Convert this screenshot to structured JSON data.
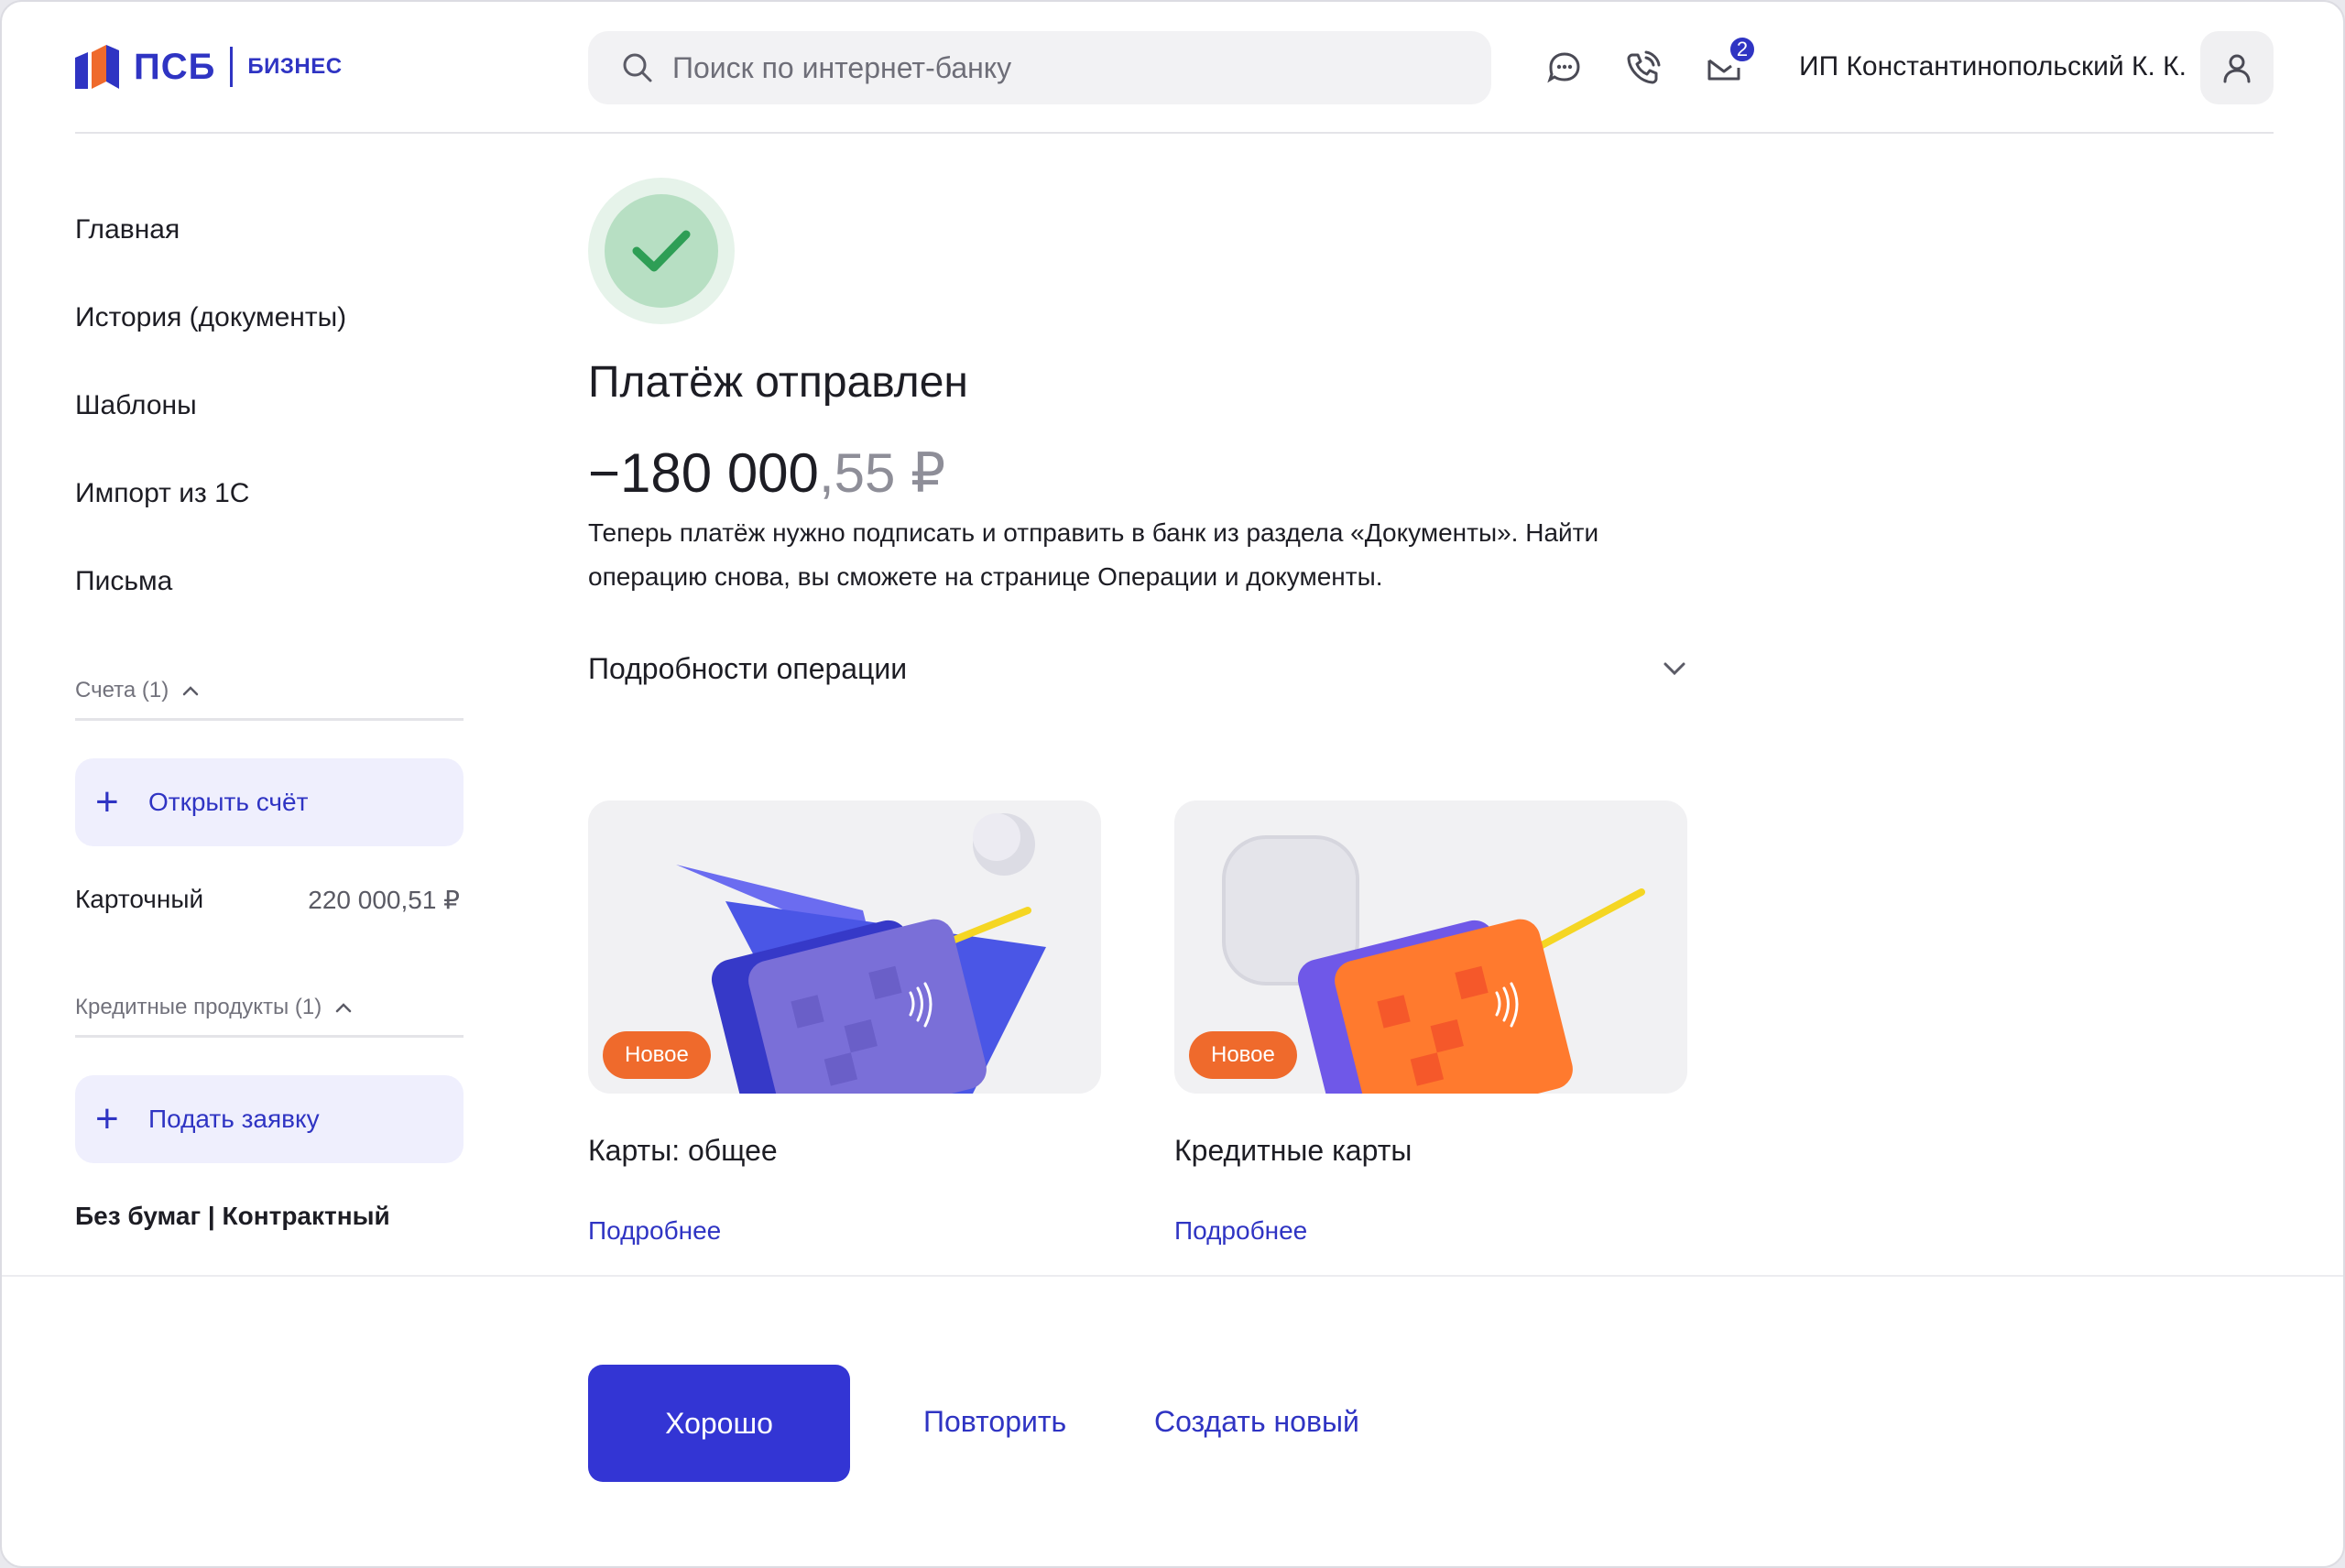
{
  "brand": {
    "name": "ПСБ",
    "sub": "БИЗНЕС"
  },
  "header": {
    "search_placeholder": "Поиск по интернет-банку",
    "notification_count": "2",
    "user_name": "ИП Константинопольский К. К."
  },
  "sidebar": {
    "nav": [
      "Главная",
      "История (документы)",
      "Шаблоны",
      "Импорт из 1С",
      "Письма"
    ],
    "accounts_title": "Счета (1)",
    "open_account_label": "Открыть счёт",
    "account": {
      "name": "Карточный",
      "balance": "220 000,51 ₽"
    },
    "credit_title": "Кредитные продукты (1)",
    "apply_label": "Подать заявку",
    "footer_note": "Без бумаг | Контрактный"
  },
  "main": {
    "status_title": "Платёж отправлен",
    "amount_main": "−180 000",
    "amount_frac": ",55 ₽",
    "description": "Теперь платёж нужно подписать и отправить в банк из раздела «Документы». Найти операцию снова, вы сможете на странице Операции и документы.",
    "details_label": "Подробности операции",
    "offers": [
      {
        "badge": "Новое",
        "title": "Карты: общее",
        "link": "Подробнее"
      },
      {
        "badge": "Новое",
        "title": "Кредитные карты",
        "link": "Подробнее"
      }
    ]
  },
  "actions": {
    "ok": "Хорошо",
    "repeat": "Повторить",
    "create_new": "Создать новый"
  },
  "colors": {
    "accent": "#2f34c3",
    "primary_button": "#3335d4",
    "badge": "#ef6a2c",
    "success": "#2e9e55"
  }
}
